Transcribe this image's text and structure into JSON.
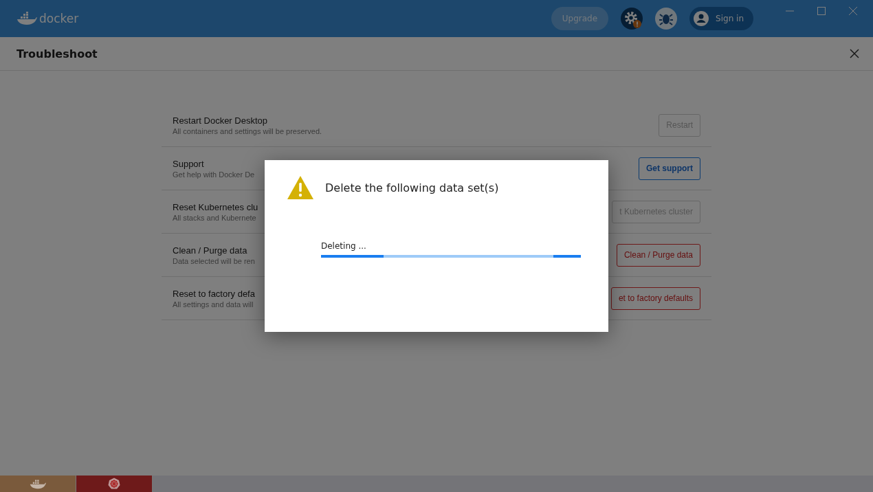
{
  "top_bar": {
    "logo_text": "docker",
    "upgrade_button": "Upgrade",
    "sign_in_button": "Sign in"
  },
  "page": {
    "title": "Troubleshoot"
  },
  "rows": [
    {
      "title": "Restart Docker Desktop",
      "description": "All containers and settings will be preserved.",
      "button": {
        "label": "Restart",
        "kind": "disabled"
      }
    },
    {
      "title": "Support",
      "description": "Get help with Docker De",
      "button": {
        "label": "Get support",
        "kind": "primary"
      }
    },
    {
      "title": "Reset Kubernetes clu",
      "description": "All stacks and Kubernete",
      "button": {
        "label": "t Kubernetes cluster",
        "kind": "disabled"
      }
    },
    {
      "title": "Clean / Purge data",
      "description": "Data selected will be ren",
      "button": {
        "label": "Clean / Purge data",
        "kind": "danger"
      }
    },
    {
      "title": "Reset to factory defa",
      "description": "All settings and data will",
      "button": {
        "label": "et to factory defaults",
        "kind": "danger"
      }
    }
  ],
  "dialog": {
    "title": "Delete the following data set(s)",
    "progress_label": "Deleting ...",
    "level": 0.24
  },
  "status_bar": [
    {
      "kind": "docker",
      "color": "#7a5a3c"
    },
    {
      "kind": "kubernetes",
      "color": "#6e1a1a"
    }
  ]
}
